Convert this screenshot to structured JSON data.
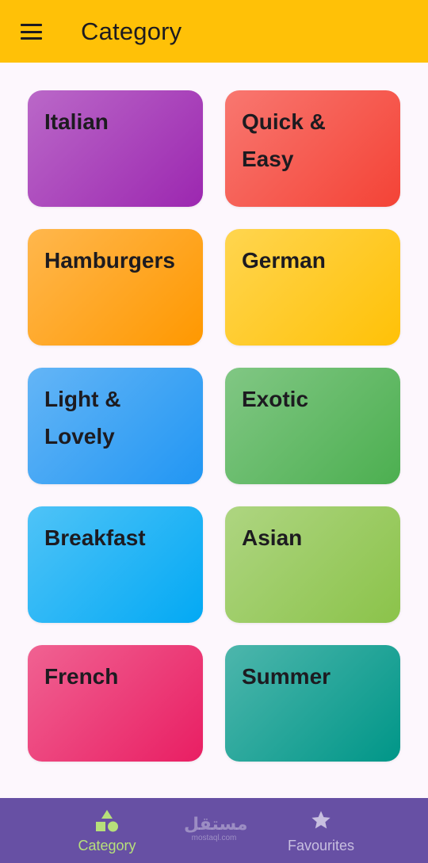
{
  "app_bar": {
    "title": "Category"
  },
  "categories": [
    {
      "label": "Italian",
      "from": "#ba68c8",
      "to": "#9c27b0"
    },
    {
      "label": "Quick & Easy",
      "from": "#f87770",
      "to": "#f44336"
    },
    {
      "label": "Hamburgers",
      "from": "#ffb74d",
      "to": "#ff9800"
    },
    {
      "label": "German",
      "from": "#ffd54f",
      "to": "#ffc107"
    },
    {
      "label": "Light & Lovely",
      "from": "#64b5f6",
      "to": "#2196f3"
    },
    {
      "label": "Exotic",
      "from": "#81c784",
      "to": "#4caf50"
    },
    {
      "label": "Breakfast",
      "from": "#4fc3f7",
      "to": "#03a9f4"
    },
    {
      "label": "Asian",
      "from": "#aed581",
      "to": "#8bc34a"
    },
    {
      "label": "French",
      "from": "#f06292",
      "to": "#e91e63"
    },
    {
      "label": "Summer",
      "from": "#4db6ac",
      "to": "#009688"
    }
  ],
  "bottom_nav": {
    "category_label": "Category",
    "favourites_label": "Favourites",
    "active_color": "#b7e07a"
  },
  "watermark": {
    "main": "مستقل",
    "sub": "mostaql.com"
  }
}
